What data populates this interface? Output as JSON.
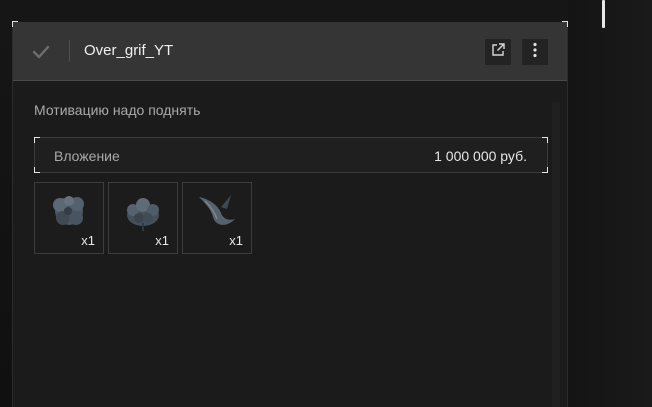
{
  "header": {
    "title": "Over_grif_YT",
    "check_icon": "check-icon",
    "external_icon": "external-link-icon",
    "more_icon": "more-vertical-icon"
  },
  "message": "Мотивацию надо поднять",
  "investment": {
    "label": "Вложение",
    "value": "1 000 000 руб."
  },
  "items": [
    {
      "icon": "blue-flower-cluster-icon",
      "qty": "x1"
    },
    {
      "icon": "blue-flower-bush-icon",
      "qty": "x1"
    },
    {
      "icon": "curved-claw-icon",
      "qty": "x1"
    }
  ],
  "colors": {
    "header_bg": "#353535",
    "panel_bg": "#1b1b1b",
    "accent_white": "#f0f0f0",
    "muted_text": "#a9a9a9"
  }
}
